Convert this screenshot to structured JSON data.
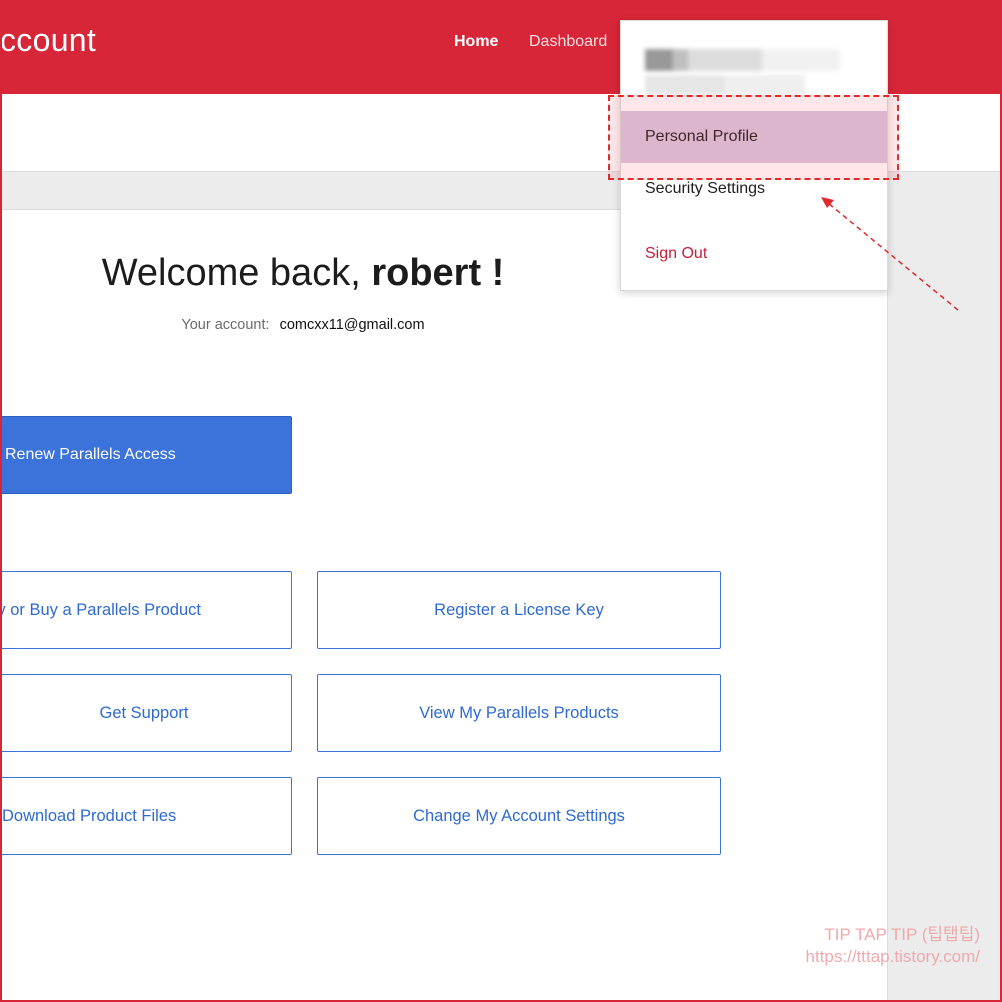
{
  "header": {
    "brand": "ccount",
    "nav": {
      "home": "Home",
      "dashboard": "Dashboard"
    }
  },
  "main": {
    "welcome_prefix": "Welcome back,",
    "username": "robert !",
    "account_label": "Your account:",
    "account_email": "comcxx11@gmail.com",
    "renew_button": "Renew Parallels Access",
    "tiles": {
      "try_buy": "y or Buy a Parallels Product",
      "register_key": "Register a License Key",
      "get_support": "Get Support",
      "view_products": "View My Parallels Products",
      "download_files": "Download Product Files",
      "change_settings": "Change My Account Settings"
    }
  },
  "dropdown": {
    "items": [
      {
        "label": "Personal Profile"
      },
      {
        "label": "Security Settings"
      },
      {
        "label": "Sign Out"
      }
    ]
  },
  "watermark": {
    "line1": "TIP TAP TIP (팁탭팁)",
    "line2": "https://tttap.tistory.com/"
  },
  "colors": {
    "brand_red": "#d72638",
    "primary_blue": "#3b73db",
    "highlight_purple": "#d5c7e0",
    "annotation_red": "#e12a2a"
  }
}
